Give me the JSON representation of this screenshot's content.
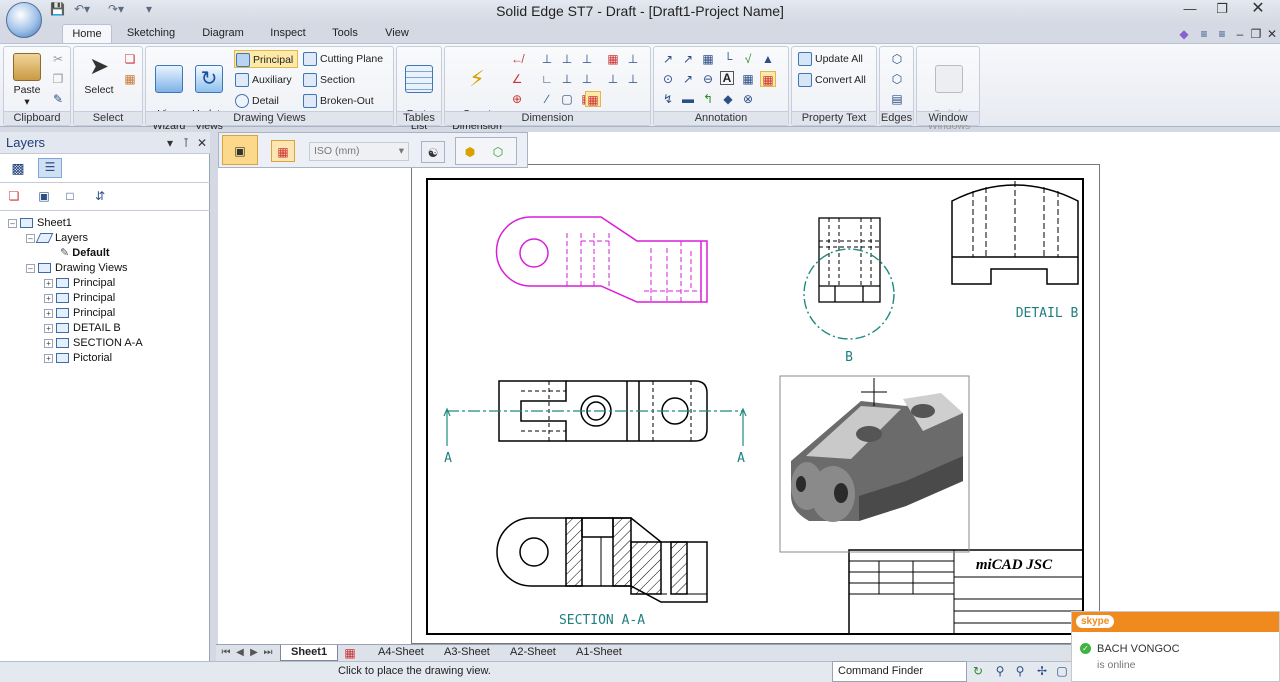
{
  "window": {
    "title": "Solid Edge ST7 - Draft - [Draft1-Project Name]"
  },
  "colors": {
    "accent": "#f0891e",
    "magenta": "#d81ed8",
    "teal": "#1f8a7d",
    "tab_active": "#fde9a8"
  },
  "tabs": [
    "Home",
    "Sketching",
    "Diagram",
    "Inspect",
    "Tools",
    "View"
  ],
  "ribbon": {
    "clipboard": {
      "label": "Clipboard",
      "paste": "Paste"
    },
    "select": {
      "label": "Select",
      "select": "Select"
    },
    "drawing_views": {
      "label": "Drawing Views",
      "view_wizard": "View\nWizard",
      "update_views": "Update\nViews",
      "principal": "Principal",
      "auxiliary": "Auxiliary",
      "detail": "Detail",
      "cutting_plane": "Cutting Plane",
      "section": "Section",
      "broken_out": "Broken-Out"
    },
    "tables": {
      "label": "Tables",
      "parts_list": "Parts\nList"
    },
    "dimension": {
      "label": "Dimension",
      "smart_dimension": "Smart\nDimension"
    },
    "annotation": {
      "label": "Annotation"
    },
    "property_text": {
      "label": "Property Text",
      "update_all": "Update All",
      "convert_all": "Convert All"
    },
    "edges": {
      "label": "Edges"
    },
    "window": {
      "label": "Window",
      "switch_windows": "Switch\nWindows"
    }
  },
  "layers_panel": {
    "title": "Layers",
    "tree": {
      "sheet": "Sheet1",
      "layers": "Layers",
      "default": "Default",
      "drawing_views": "Drawing Views",
      "views": [
        "Principal",
        "Principal",
        "Principal",
        "DETAIL B",
        "SECTION A-A",
        "Pictorial"
      ]
    }
  },
  "view_toolbar": {
    "standard": "ISO (mm)"
  },
  "drawing": {
    "detail_label": "DETAIL B",
    "detail_callout": "B",
    "section_mark": "A",
    "section_label": "SECTION A-A",
    "company": "miCAD JSC"
  },
  "sheet_tabs": [
    "Sheet1",
    "A4-Sheet",
    "A3-Sheet",
    "A2-Sheet",
    "A1-Sheet"
  ],
  "status": {
    "prompt": "Click to place the drawing view.",
    "command_finder": "Command Finder"
  },
  "skype": {
    "logo": "skype",
    "name": "BACH VONGOC",
    "status": "is online"
  }
}
